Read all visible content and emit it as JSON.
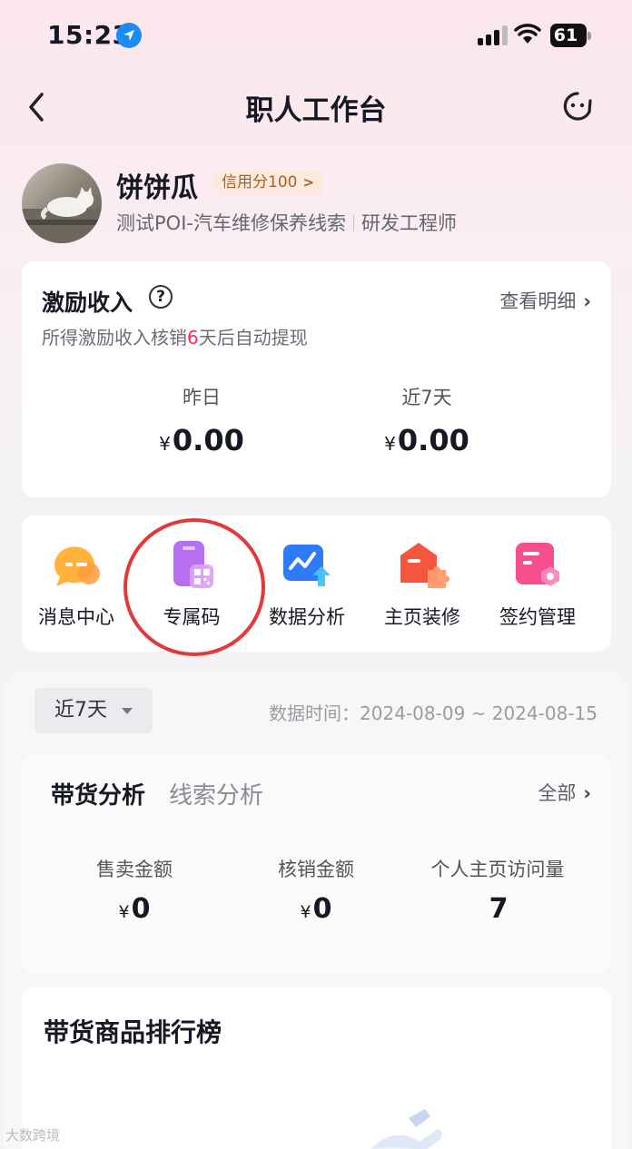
{
  "status_bar": {
    "time": "15:23",
    "battery": "61"
  },
  "nav": {
    "title": "职人工作台"
  },
  "profile": {
    "name": "饼饼瓜",
    "credit_badge": "信用分100",
    "org": "测试POI-汽车维修保养线索",
    "role": "研发工程师"
  },
  "income": {
    "title": "激励收入",
    "detail_link": "查看明细",
    "note_prefix": "所得激励收入核销",
    "note_days": "6",
    "note_suffix": "天后自动提现",
    "currency": "¥",
    "yesterday_label": "昨日",
    "yesterday_value": "0.00",
    "week_label": "近7天",
    "week_value": "0.00"
  },
  "tools": [
    {
      "label": "消息中心",
      "icon": "message-center-icon"
    },
    {
      "label": "专属码",
      "icon": "exclusive-code-icon"
    },
    {
      "label": "数据分析",
      "icon": "data-analysis-icon"
    },
    {
      "label": "主页装修",
      "icon": "homepage-decoration-icon"
    },
    {
      "label": "签约管理",
      "icon": "contract-management-icon"
    }
  ],
  "filter": {
    "period": "近7天",
    "data_time": "数据时间：2024-08-09 ~ 2024-08-15"
  },
  "analysis": {
    "tabs": [
      "带货分析",
      "线索分析"
    ],
    "all_link": "全部",
    "metrics": [
      {
        "label": "售卖金额",
        "currency": "¥",
        "value": "0"
      },
      {
        "label": "核销金额",
        "currency": "¥",
        "value": "0"
      },
      {
        "label": "个人主页访问量",
        "currency": "",
        "value": "7"
      }
    ]
  },
  "ranking": {
    "title": "带货商品排行榜"
  },
  "watermark": "大数跨境",
  "colors": {
    "accent": "#fe2c55",
    "highlight_ring": "#e23a3a",
    "location_blue": "#1c8cf5"
  }
}
